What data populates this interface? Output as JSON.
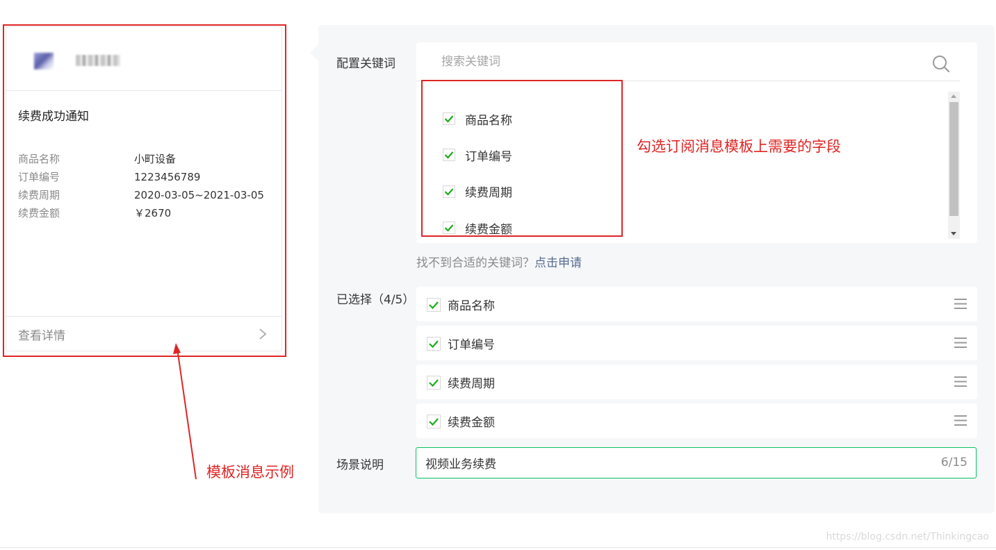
{
  "preview_card": {
    "title": "续费成功通知",
    "fields": [
      {
        "label": "商品名称",
        "value": "小町设备"
      },
      {
        "label": "订单编号",
        "value": "1223456789"
      },
      {
        "label": "续费周期",
        "value": "2020-03-05~2021-03-05"
      },
      {
        "label": "续费金额",
        "value": "￥2670"
      }
    ],
    "footer_label": "查看详情"
  },
  "annotations": {
    "template_example": "模板消息示例",
    "keyword_hint": "勾选订阅消息模板上需要的字段",
    "color": "#e02424"
  },
  "config": {
    "keyword_label": "配置关键词",
    "search_placeholder": "搜索关键词",
    "keywords": [
      {
        "label": "商品名称",
        "checked": true
      },
      {
        "label": "订单编号",
        "checked": true
      },
      {
        "label": "续费周期",
        "checked": true
      },
      {
        "label": "续费金额",
        "checked": true
      }
    ],
    "hint_text": "找不到合适的关键词？",
    "hint_link": "点击申请",
    "selected_label": "已选择（4/5）",
    "selected": [
      {
        "label": "商品名称"
      },
      {
        "label": "订单编号"
      },
      {
        "label": "续费周期"
      },
      {
        "label": "续费金额"
      }
    ],
    "scene_label": "场景说明",
    "scene_value": "视频业务续费",
    "scene_counter": "6/15"
  },
  "watermark": "https://blog.csdn.net/Thinkingcao",
  "colors": {
    "accent_green": "#07c160",
    "link_blue": "#576b95",
    "panel_bg": "#f6f7f9"
  }
}
